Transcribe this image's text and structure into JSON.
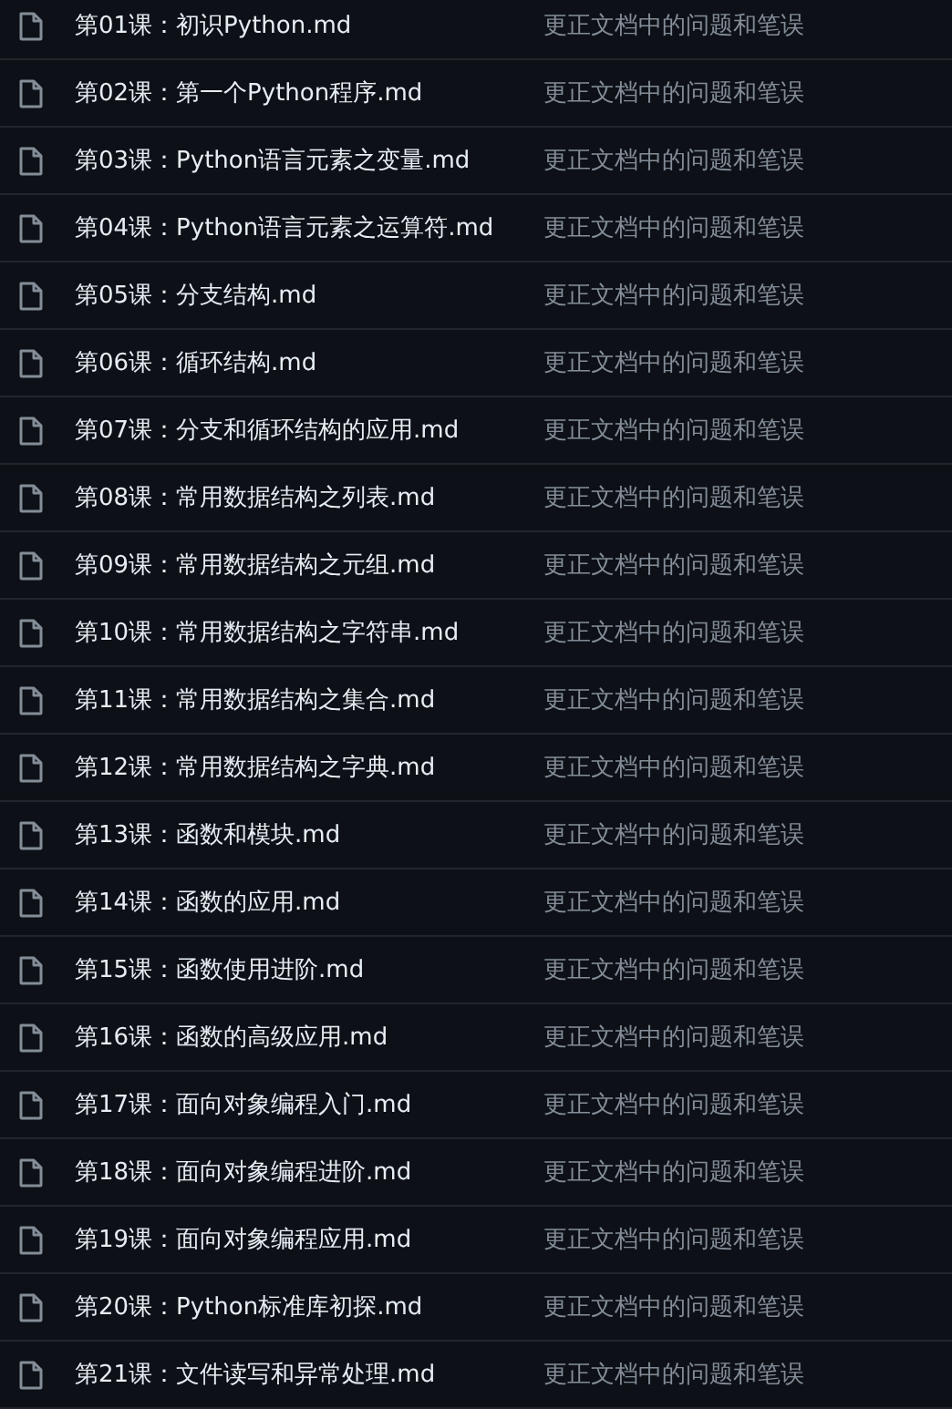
{
  "files": [
    {
      "name": "第01课：初识Python.md",
      "message": "更正文档中的问题和笔误"
    },
    {
      "name": "第02课：第一个Python程序.md",
      "message": "更正文档中的问题和笔误"
    },
    {
      "name": "第03课：Python语言元素之变量.md",
      "message": "更正文档中的问题和笔误"
    },
    {
      "name": "第04课：Python语言元素之运算符.md",
      "message": "更正文档中的问题和笔误"
    },
    {
      "name": "第05课：分支结构.md",
      "message": "更正文档中的问题和笔误"
    },
    {
      "name": "第06课：循环结构.md",
      "message": "更正文档中的问题和笔误"
    },
    {
      "name": "第07课：分支和循环结构的应用.md",
      "message": "更正文档中的问题和笔误"
    },
    {
      "name": "第08课：常用数据结构之列表.md",
      "message": "更正文档中的问题和笔误"
    },
    {
      "name": "第09课：常用数据结构之元组.md",
      "message": "更正文档中的问题和笔误"
    },
    {
      "name": "第10课：常用数据结构之字符串.md",
      "message": "更正文档中的问题和笔误"
    },
    {
      "name": "第11课：常用数据结构之集合.md",
      "message": "更正文档中的问题和笔误"
    },
    {
      "name": "第12课：常用数据结构之字典.md",
      "message": "更正文档中的问题和笔误"
    },
    {
      "name": "第13课：函数和模块.md",
      "message": "更正文档中的问题和笔误"
    },
    {
      "name": "第14课：函数的应用.md",
      "message": "更正文档中的问题和笔误"
    },
    {
      "name": "第15课：函数使用进阶.md",
      "message": "更正文档中的问题和笔误"
    },
    {
      "name": "第16课：函数的高级应用.md",
      "message": "更正文档中的问题和笔误"
    },
    {
      "name": "第17课：面向对象编程入门.md",
      "message": "更正文档中的问题和笔误"
    },
    {
      "name": "第18课：面向对象编程进阶.md",
      "message": "更正文档中的问题和笔误"
    },
    {
      "name": "第19课：面向对象编程应用.md",
      "message": "更正文档中的问题和笔误"
    },
    {
      "name": "第20课：Python标准库初探.md",
      "message": "更正文档中的问题和笔误"
    },
    {
      "name": "第21课：文件读写和异常处理.md",
      "message": "更正文档中的问题和笔误"
    }
  ]
}
